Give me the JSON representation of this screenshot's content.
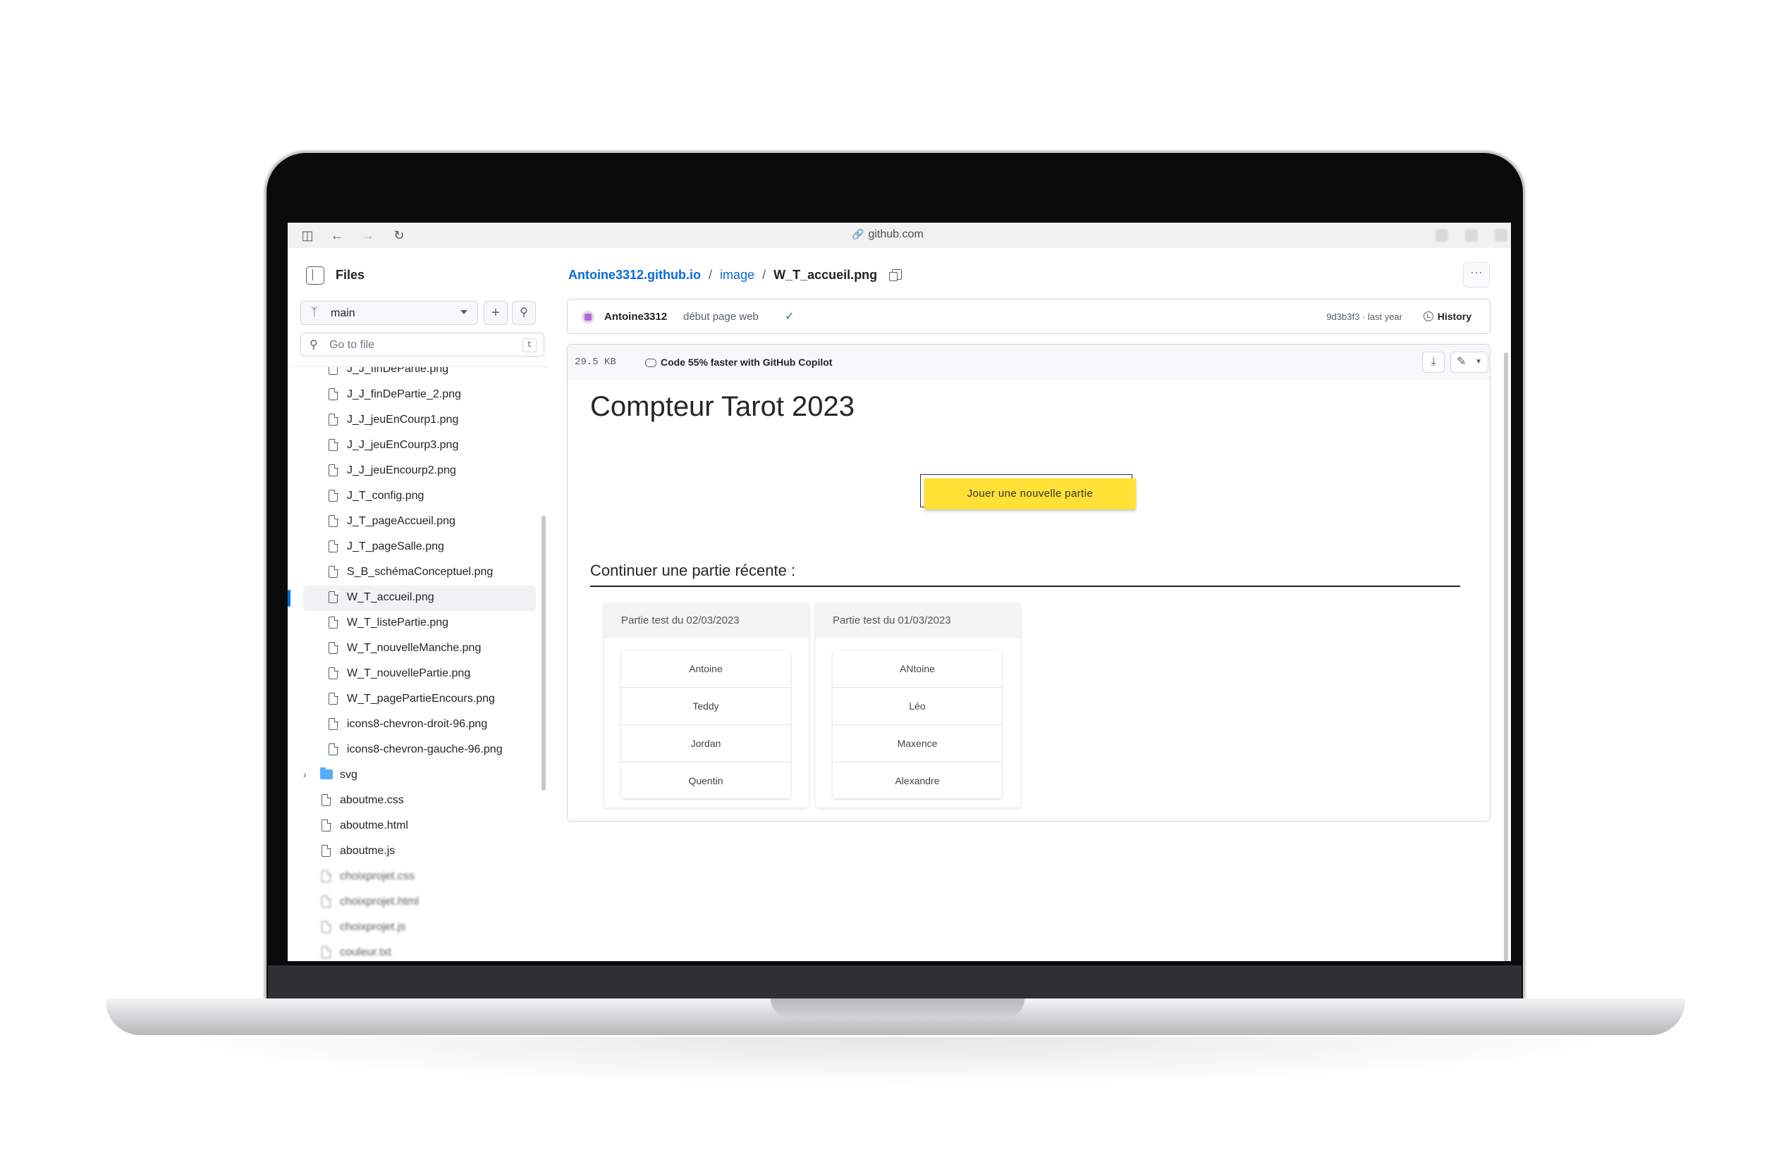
{
  "browser": {
    "url": "github.com"
  },
  "sidebar": {
    "title": "Files",
    "branch": "main",
    "goto_placeholder": "Go to file",
    "goto_shortcut": "t",
    "tree": [
      {
        "name": "J_J_finDePartie.png",
        "type": "file"
      },
      {
        "name": "J_J_finDePartie_2.png",
        "type": "file"
      },
      {
        "name": "J_J_jeuEnCourp1.png",
        "type": "file"
      },
      {
        "name": "J_J_jeuEnCourp3.png",
        "type": "file"
      },
      {
        "name": "J_J_jeuEncourp2.png",
        "type": "file"
      },
      {
        "name": "J_T_config.png",
        "type": "file"
      },
      {
        "name": "J_T_pageAccueil.png",
        "type": "file"
      },
      {
        "name": "J_T_pageSalle.png",
        "type": "file"
      },
      {
        "name": "S_B_schémaConceptuel.png",
        "type": "file"
      },
      {
        "name": "W_T_accueil.png",
        "type": "file",
        "active": true
      },
      {
        "name": "W_T_listePartie.png",
        "type": "file"
      },
      {
        "name": "W_T_nouvelleManche.png",
        "type": "file"
      },
      {
        "name": "W_T_nouvellePartie.png",
        "type": "file"
      },
      {
        "name": "W_T_pagePartieEncours.png",
        "type": "file"
      },
      {
        "name": "icons8-chevron-droit-96.png",
        "type": "file"
      },
      {
        "name": "icons8-chevron-gauche-96.png",
        "type": "file"
      },
      {
        "name": "svg",
        "type": "folder"
      },
      {
        "name": "aboutme.css",
        "type": "file"
      },
      {
        "name": "aboutme.html",
        "type": "file"
      },
      {
        "name": "aboutme.js",
        "type": "file"
      },
      {
        "name": "choixprojet.css",
        "type": "file"
      },
      {
        "name": "choixprojet.html",
        "type": "file"
      },
      {
        "name": "choixprojet.js",
        "type": "file"
      },
      {
        "name": "couleur.txt",
        "type": "file"
      }
    ]
  },
  "breadcrumb": {
    "repo": "Antoine3312.github.io",
    "sep1": "/",
    "folder": "image",
    "sep2": "/",
    "file": "W_T_accueil.png"
  },
  "commit": {
    "author": "Antoine3312",
    "message": "début page web",
    "hash_time": "9d3b3f3 · last year",
    "history_label": "History"
  },
  "file_header": {
    "size": "29.5 KB",
    "copilot": "Code 55% faster with GitHub Copilot"
  },
  "preview": {
    "title": "Compteur Tarot 2023",
    "play_button": "Jouer une nouvelle partie",
    "continue_heading": "Continuer une partie récente :",
    "games": [
      {
        "title": "Partie test du 02/03/2023",
        "players": [
          "Antoine",
          "Teddy",
          "Jordan",
          "Quentin"
        ]
      },
      {
        "title": "Partie test du 01/03/2023",
        "players": [
          "ANtoine",
          "Léo",
          "Maxence",
          "Alexandre"
        ]
      }
    ],
    "button_color": "#ffe135"
  },
  "colors": {
    "link": "#0969da",
    "folder": "#54aeff",
    "success": "#1a7f37"
  }
}
